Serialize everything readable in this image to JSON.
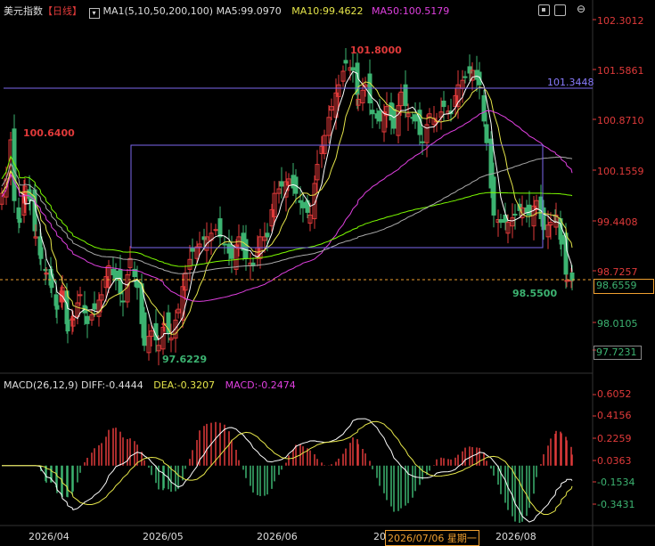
{
  "header": {
    "title": "美元指数",
    "period": "【日线】",
    "toggle_icon": "⊖",
    "ma_label": "MA1(5,10,50,200,100)",
    "ma5": "MA5:99.0970",
    "ma10": "MA10:99.4622",
    "ma50": "MA50:100.5179"
  },
  "macd_header": {
    "label": "MACD(26,12,9)",
    "diff": "DIFF:-0.4444",
    "dea": "DEA:-0.3207",
    "macd": "MACD:-0.2474"
  },
  "price_axis": [
    "102.3012",
    "101.5861",
    "100.8710",
    "100.1559",
    "99.4408",
    "98.7257",
    "98.0105",
    "97.7231"
  ],
  "current_price": "98.6559",
  "macd_axis": [
    "0.6052",
    "0.4156",
    "0.2259",
    "0.0363",
    "-0.1534",
    "-0.3431"
  ],
  "annotations": {
    "high": "101.8000",
    "left_high": "100.6400",
    "low": "97.6229",
    "recent_low": "98.5500",
    "hline": "101.3448"
  },
  "date_labels": [
    "2026/04",
    "2026/05",
    "2026/06",
    "20",
    "2026/07/06 星期一",
    "2026/08"
  ],
  "colors": {
    "up": "#e03a3a",
    "down": "#3cb371",
    "ma5": "#ffffff",
    "ma10": "#e5e54a",
    "ma50": "#e040e0",
    "ma200": "#7cfc00",
    "ma100": "#aaaaaa",
    "box": "#7b68ee",
    "axis_text": "#e03a3a",
    "diff": "#ffffff",
    "dea": "#e5e54a",
    "macd_label": "#e040e0",
    "date_hilite": "#f0a030"
  },
  "icons": [
    "title-dropdown-icon",
    "settings-icon",
    "close-icon"
  ]
}
